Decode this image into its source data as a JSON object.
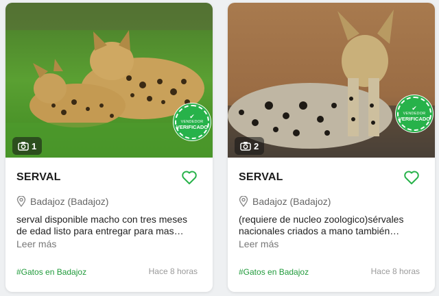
{
  "colors": {
    "accent": "#27b24a",
    "tag": "#1f9a3a",
    "page_bg": "#eef0f2"
  },
  "listings": [
    {
      "photo_count": "1",
      "badge_line1": "VENDEDOR",
      "badge_line2": "VERIFICADO",
      "title": "SERVAL",
      "location": "Badajoz (Badajoz)",
      "description": "serval disponible macho con tres meses de edad listo para entregar para mas…",
      "read_more": "Leer más",
      "tag": "#Gatos en Badajoz",
      "time": "Hace 8 horas",
      "icons": [
        "camera-icon",
        "heart-icon",
        "location-pin-icon",
        "check-icon"
      ]
    },
    {
      "photo_count": "2",
      "badge_line1": "VENDEDOR",
      "badge_line2": "VERIFICADO",
      "title": "SERVAL",
      "location": "Badajoz (Badajoz)",
      "description": "(requiere de nucleo zoologico)sérvales nacionales criados a mano también…",
      "read_more": "Leer más",
      "tag": "#Gatos en Badajoz",
      "time": "Hace 8 horas",
      "icons": [
        "camera-icon",
        "heart-icon",
        "location-pin-icon",
        "check-icon"
      ]
    }
  ]
}
